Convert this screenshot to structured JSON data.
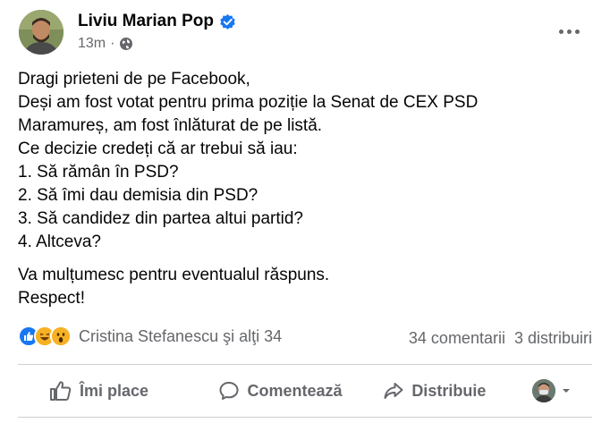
{
  "post": {
    "author": "Liviu Marian Pop",
    "time": "13m",
    "audience_icon": "globe-icon",
    "verified_icon": "verified-badge-icon",
    "more_icon": "more-options-icon",
    "paragraphs": [
      [
        "Dragi prieteni de pe Facebook,",
        "Deși am fost votat pentru prima poziție la Senat de CEX  PSD",
        "Maramureș, am fost înlăturat de pe listă.",
        "Ce decizie credeți că ar trebui să iau:",
        "1. Să rămân în PSD?",
        "2. Să îmi dau demisia din PSD?",
        "3. Să candidez din partea altui partid?",
        "4. Altceva?"
      ],
      [
        "Va mulțumesc pentru eventualul răspuns.",
        "Respect!"
      ]
    ]
  },
  "reactions": {
    "icons": [
      "like-reaction-icon",
      "haha-reaction-icon",
      "wow-reaction-icon"
    ],
    "names": "Cristina Stefanescu şi alţi 34",
    "comments": "34 comentarii",
    "shares": "3 distribuiri"
  },
  "actions": {
    "like": "Îmi place",
    "comment": "Comentează",
    "share": "Distribuie"
  },
  "colors": {
    "accent": "#1877f2",
    "secondary_text": "#65676b",
    "divider": "#ced0d4"
  }
}
